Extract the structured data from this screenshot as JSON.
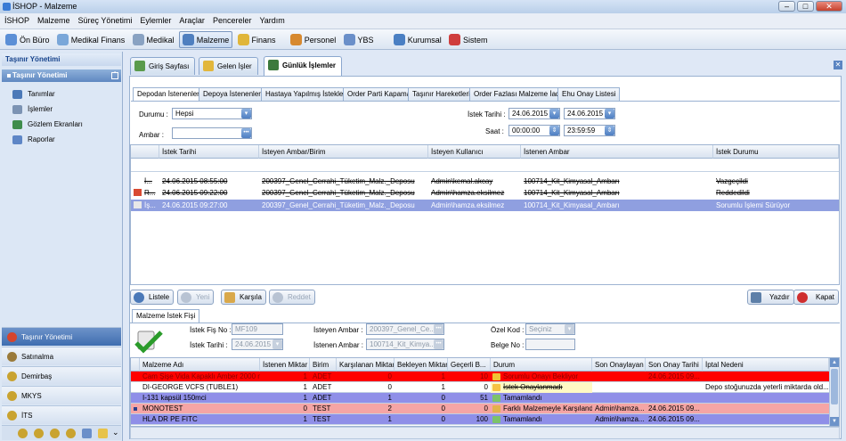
{
  "window": {
    "title": "İSHOP - Malzeme",
    "min": "–",
    "max": "□",
    "close": "✕"
  },
  "menu": [
    "İSHOP",
    "Malzeme",
    "Süreç Yönetimi",
    "Eylemler",
    "Araçlar",
    "Pencereler",
    "Yardım"
  ],
  "modules": [
    "Ön Büro",
    "Medikal Finans",
    "Medikal",
    "Malzeme",
    "Finans",
    "Personel",
    "YBS",
    "Kurumsal",
    "Sistem"
  ],
  "sidebar": {
    "header": "Taşınır Yönetimi",
    "section": "Taşınır Yönetimi",
    "items": [
      "Tanımlar",
      "İşlemler",
      "Gözlem Ekranları",
      "Raporlar"
    ],
    "nav": [
      "Taşınır Yönetimi",
      "Satınalma",
      "Demirbaş",
      "MKYS",
      "İTS"
    ]
  },
  "tabs": [
    "Giriş Sayfası",
    "Gelen İşler",
    "Günlük İşlemler"
  ],
  "subtabs": [
    "Depodan İstenenler",
    "Depoya İstenenler",
    "Hastaya Yapılmış İstekler",
    "Order Parti Kapama",
    "Taşınır Hareketleri",
    "Order Fazlası Malzeme İade",
    "Ehu Onay Listesi"
  ],
  "filters": {
    "durum_label": "Durumu :",
    "durum_value": "Hepsi",
    "ambar_label": "Ambar :",
    "ambar_value": "",
    "tarih_label": "İstek Tarihi :",
    "tarih_from": "24.06.2015",
    "tarih_to": "24.06.2015",
    "saat_label": "Saat :",
    "saat_from": "00:00:00",
    "saat_to": "23:59:59"
  },
  "grid1": {
    "headers": [
      "İstek Tarihi",
      "İsteyen Ambar/Birim",
      "İsteyen Kullanıcı",
      "İstenen Ambar",
      "İstek Durumu"
    ],
    "rows": [
      {
        "pre": "İ...",
        "tarih": "24.06.2015 08:55:00",
        "ambar": "200397_Genel_Cerrahi_Tüketim_Malz._Deposu",
        "kullanici": "Admin\\kemal.akcay",
        "istenen": "100714_Kit_Kimyasal_Ambarı",
        "durum": "Vazgeçildi"
      },
      {
        "pre": "R...",
        "tarih": "24.06.2015 09:22:00",
        "ambar": "200397_Genel_Cerrahi_Tüketim_Malz._Deposu",
        "kullanici": "Admin\\hamza.eksilmez",
        "istenen": "100714_Kit_Kimyasal_Ambarı",
        "durum": "Reddedildi"
      },
      {
        "pre": "İş...",
        "tarih": "24.06.2015 09:27:00",
        "ambar": "200397_Genel_Cerrahi_Tüketim_Malz._Deposu",
        "kullanici": "Admin\\hamza.eksilmez",
        "istenen": "100714_Kit_Kimyasal_Ambarı",
        "durum": "Sorumlu İşlemi Sürüyor"
      }
    ]
  },
  "buttons": {
    "listele": "Listele",
    "yeni": "Yeni",
    "karsila": "Karşıla",
    "reddet": "Reddet",
    "yazdir": "Yazdır",
    "kapat": "Kapat"
  },
  "detail": {
    "tab": "Malzeme İstek Fişi",
    "fis_label": "İstek Fiş No :",
    "fis_value": "MF109",
    "tarih_label": "İstek Tarihi :",
    "tarih_value": "24.06.2015",
    "isteyen_label": "İsteyen Ambar :",
    "isteyen_value": "200397_Genel_Ce...",
    "istenen_label": "İstenen Ambar :",
    "istenen_value": "100714_Kit_Kimya...",
    "ozel_label": "Özel Kod :",
    "ozel_value": "Seçiniz",
    "belge_label": "Belge No :",
    "belge_value": ""
  },
  "grid2": {
    "headers": [
      "Malzeme Adı",
      "İstenen Miktar",
      "Birim",
      "Karşılanan Miktar",
      "Bekleyen Miktar",
      "Geçerli B...",
      "Durum",
      "Son Onaylayan",
      "Son Onay Tarihi",
      "İptal Nedeni"
    ],
    "rows": [
      {
        "ad": "Cam Şişe Vida Kapaklı Amber 2000 ml",
        "istenen": "1",
        "birim": "ADET",
        "karsilanan": "0",
        "bekleyen": "1",
        "gecerli": "10",
        "durum": "Sorumlu Onayı Bekliyor",
        "onaylayan": "",
        "tarih": "24.06.2015 09...",
        "iptal": "",
        "bg": "#ff0000",
        "color": "#8a0000"
      },
      {
        "ad": "DI-GEORGE VCFS (TUBLE1)",
        "istenen": "1",
        "birim": "ADET",
        "karsilanan": "0",
        "bekleyen": "1",
        "gecerli": "0",
        "durum": "İstek Onaylanmadı",
        "onaylayan": "",
        "tarih": "",
        "iptal": "Depo stoğunuzda yeterli miktarda old...",
        "bg": "#ffffff",
        "color": "#000000"
      },
      {
        "ad": "I-131 kapsül 150mci",
        "istenen": "1",
        "birim": "ADET",
        "karsilanan": "1",
        "bekleyen": "0",
        "gecerli": "51",
        "durum": "Tamamlandı",
        "onaylayan": "",
        "tarih": "",
        "iptal": "",
        "bg": "#8f8fe8",
        "color": "#000000"
      },
      {
        "ad": "MONOTEST",
        "istenen": "0",
        "birim": "TEST",
        "karsilanan": "2",
        "bekleyen": "0",
        "gecerli": "0",
        "durum": "Farklı Malzemeyle Karşılandı",
        "onaylayan": "Admin\\hamza...",
        "tarih": "24.06.2015 09...",
        "iptal": "",
        "bg": "#f5a5a5",
        "color": "#000000"
      },
      {
        "ad": "HLA DR PE FITC",
        "istenen": "1",
        "birim": "TEST",
        "karsilanan": "1",
        "bekleyen": "0",
        "gecerli": "100",
        "durum": "Tamamlandı",
        "onaylayan": "Admin\\hamza...",
        "tarih": "24.06.2015 09...",
        "iptal": "",
        "bg": "#8f8fe8",
        "color": "#000000"
      }
    ]
  }
}
